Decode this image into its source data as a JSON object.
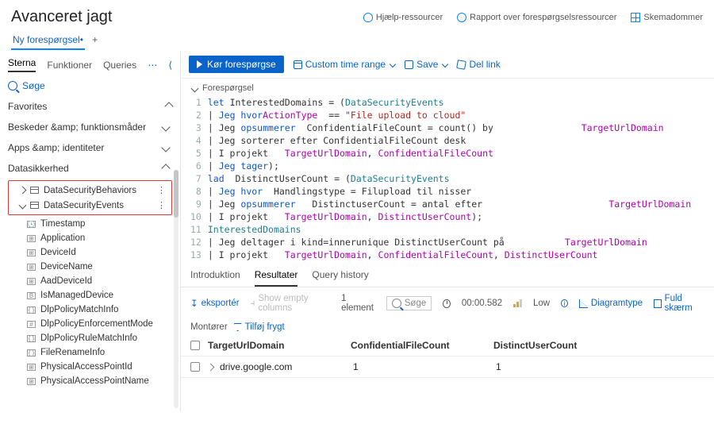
{
  "header": {
    "title": "Avanceret jagt",
    "links": {
      "help": "Hjælp-ressourcer",
      "report": "Rapport over forespørgselsressourcer",
      "schema": "Skemadommer"
    }
  },
  "tabs": {
    "new_query": "Ny forespørgsel•",
    "plus": "+"
  },
  "sidebar": {
    "tabs": {
      "schema": "Sterna",
      "functions": "Funktioner",
      "queries": "Queries"
    },
    "search": "Søge",
    "favorites": "Favorites",
    "groups": {
      "alerts": "Beskeder &amp; funktionsmåder",
      "apps": "Apps &amp; identiteter",
      "datasec": "Datasikkerhed"
    },
    "tables": {
      "behaviors": "DataSecurityBehaviors",
      "events": "DataSecurityEvents"
    },
    "columns": [
      "Timestamp",
      "Application",
      "DeviceId",
      "DeviceName",
      "AadDeviceId",
      "IsManagedDevice",
      "DlpPolicyMatchInfo",
      "DlpPolicyEnforcementMode",
      "DlpPolicyRuleMatchInfo",
      "FileRenameInfo",
      "PhysicalAccessPointId",
      "PhysicalAccessPointName"
    ],
    "colglyph": [
      "🕓",
      "⊞",
      "⊞",
      "⊞",
      "⊞",
      "B",
      "{ }",
      "#",
      "{ }",
      "{ }",
      "⊞",
      "⊞"
    ]
  },
  "toolbar": {
    "run": "Kør forespørgse",
    "timerange": "Custom time range",
    "save": "Save",
    "share": "Del link"
  },
  "query": {
    "label": "Forespørgsel",
    "lines": [
      {
        "n": "1",
        "seg": [
          {
            "c": "kw",
            "t": "let"
          },
          {
            "c": "plain",
            "t": " InterestedDomains = ("
          },
          {
            "c": "typ",
            "t": "DataSecurityEvents"
          }
        ]
      },
      {
        "n": "2",
        "seg": [
          {
            "c": "plain",
            "t": "| "
          },
          {
            "c": "kw",
            "t": "Jeg hvor"
          },
          {
            "c": "fn",
            "t": "ActionType"
          },
          {
            "c": "plain",
            "t": "  == "
          },
          {
            "c": "str",
            "t": "\"File upload to cloud\""
          }
        ]
      },
      {
        "n": "3",
        "seg": [
          {
            "c": "plain",
            "t": "| Jeg "
          },
          {
            "c": "kw",
            "t": "opsummerer"
          },
          {
            "c": "plain",
            "t": "  ConfidentialFileCount = count() by                "
          },
          {
            "c": "fn",
            "t": "TargetUrlDomain"
          }
        ]
      },
      {
        "n": "4",
        "seg": [
          {
            "c": "plain",
            "t": "| Jeg sorterer efter ConfidentialFileCount desk"
          }
        ]
      },
      {
        "n": "5",
        "seg": [
          {
            "c": "plain",
            "t": "| I projekt   "
          },
          {
            "c": "fn",
            "t": "TargetUrlDomain"
          },
          {
            "c": "plain",
            "t": ", "
          },
          {
            "c": "fn",
            "t": "ConfidentialFileCount"
          }
        ]
      },
      {
        "n": "6",
        "seg": [
          {
            "c": "plain",
            "t": "| "
          },
          {
            "c": "kw",
            "t": "Jeg tager"
          },
          {
            "c": "plain",
            "t": ");"
          }
        ]
      },
      {
        "n": "7",
        "seg": [
          {
            "c": "kw",
            "t": "lad"
          },
          {
            "c": "plain",
            "t": "  DistinctUserCount = ("
          },
          {
            "c": "typ",
            "t": "DataSecurityEvents"
          },
          {
            "c": "plain",
            "t": "                                                                          —"
          }
        ]
      },
      {
        "n": "8",
        "seg": [
          {
            "c": "plain",
            "t": "| "
          },
          {
            "c": "kw",
            "t": "Jeg hvor"
          },
          {
            "c": "plain",
            "t": "  Handlingstype = Filupload til nisser"
          }
        ]
      },
      {
        "n": "9",
        "seg": [
          {
            "c": "plain",
            "t": "| Jeg "
          },
          {
            "c": "kw",
            "t": "opsummerer"
          },
          {
            "c": "plain",
            "t": "   DistinctuserCount = antal efter                       "
          },
          {
            "c": "fn",
            "t": "TargetUrlDomain"
          }
        ]
      },
      {
        "n": "10",
        "seg": [
          {
            "c": "plain",
            "t": "| I projekt   "
          },
          {
            "c": "fn",
            "t": "TargetUrlDomain"
          },
          {
            "c": "plain",
            "t": ", "
          },
          {
            "c": "fn",
            "t": "DistinctUserCount"
          },
          {
            "c": "plain",
            "t": ");"
          }
        ]
      },
      {
        "n": "11",
        "seg": [
          {
            "c": "typ",
            "t": "InterestedDomains"
          }
        ]
      },
      {
        "n": "12",
        "seg": [
          {
            "c": "plain",
            "t": "| Jeg deltager i kind=innerunique DistinctUserCount på           "
          },
          {
            "c": "fn",
            "t": "TargetUrlDomain"
          }
        ]
      },
      {
        "n": "13",
        "seg": [
          {
            "c": "plain",
            "t": "| I projekt   "
          },
          {
            "c": "fn",
            "t": "TargetUrlDomain"
          },
          {
            "c": "plain",
            "t": ", "
          },
          {
            "c": "fn",
            "t": "ConfidentialFileCount"
          },
          {
            "c": "plain",
            "t": ", "
          },
          {
            "c": "fn",
            "t": "DistinctUserCount"
          }
        ]
      }
    ]
  },
  "results": {
    "tabs": {
      "intro": "Introduktion",
      "results": "Resultater",
      "history": "Query history"
    },
    "export": "eksportér",
    "empty": "Show empty columns",
    "count": "1 element",
    "search": "Søge",
    "time": "00:00.582",
    "low": "Low",
    "chart": "Diagramtype",
    "fullscreen": "Fuld skærm",
    "filter_label": "Montører",
    "filter_btn": "Tilføj frygt",
    "headers": [
      "TargetUrlDomain",
      "ConfidentialFileCount",
      "DistinctUserCount"
    ],
    "row": [
      "drive.google.com",
      "1",
      "1"
    ]
  }
}
